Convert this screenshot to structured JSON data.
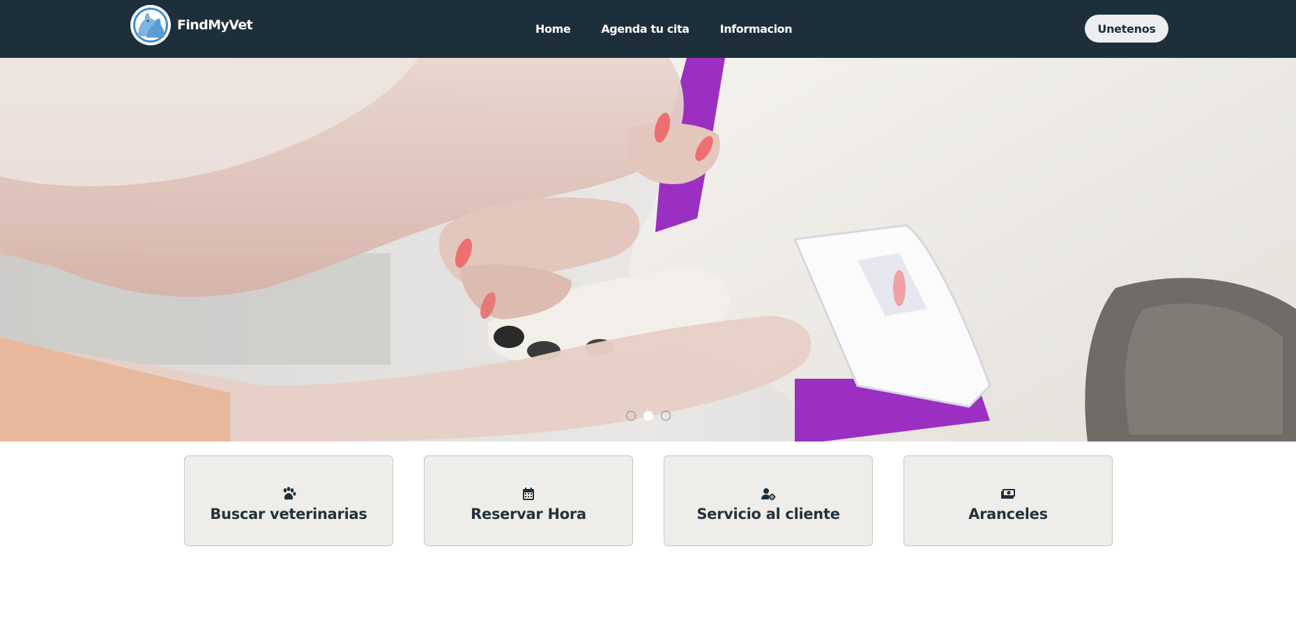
{
  "brand": {
    "name": "FindMyVet"
  },
  "nav": {
    "links": [
      {
        "label": "Home"
      },
      {
        "label": "Agenda tu cita"
      },
      {
        "label": "Informacion"
      }
    ],
    "join_label": "Unetenos"
  },
  "hero": {
    "image_icon": "vet-examining-dog-paw",
    "carousel_dots": 3,
    "active_dot": 2
  },
  "cards": [
    {
      "icon": "paw-icon",
      "title": "Buscar veterinarias"
    },
    {
      "icon": "calendar-icon",
      "title": "Reservar Hora"
    },
    {
      "icon": "user-gear-icon",
      "title": "Servicio al cliente"
    },
    {
      "icon": "money-icon",
      "title": "Aranceles"
    }
  ],
  "colors": {
    "navbar": "#1d2f3b",
    "card_bg": "#efedea",
    "card_text": "#25323c",
    "collar": "#9b2fc2"
  }
}
